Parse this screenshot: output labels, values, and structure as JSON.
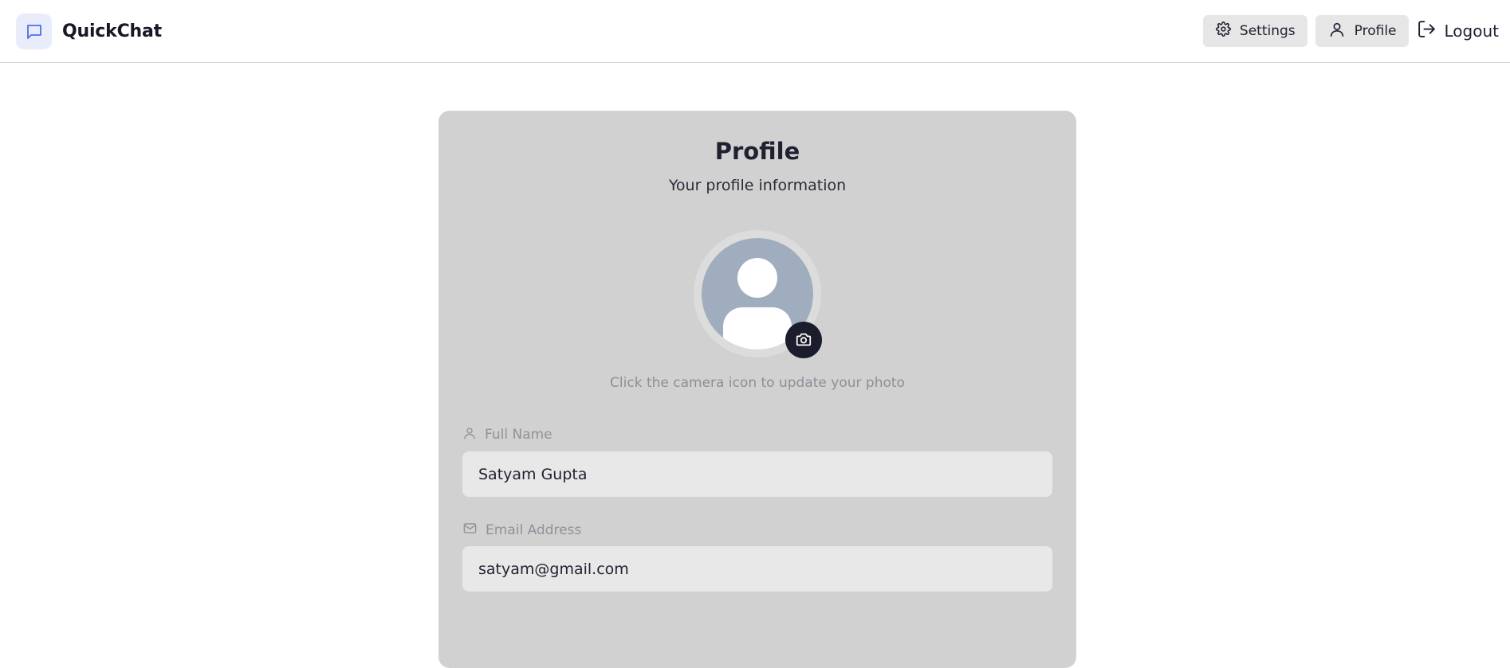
{
  "app": {
    "name": "QuickChat"
  },
  "nav": {
    "settings_label": "Settings",
    "profile_label": "Profile",
    "logout_label": "Logout"
  },
  "profile": {
    "title": "Profile",
    "subtitle": "Your profile information",
    "photo_hint": "Click the camera icon to update your photo",
    "full_name": {
      "label": "Full Name",
      "value": "Satyam Gupta"
    },
    "email": {
      "label": "Email Address",
      "value": "satyam@gmail.com"
    }
  },
  "colors": {
    "brand_accent": "#4f6bed",
    "card_background": "#d1d1d1",
    "camera_button": "#1c1d2c",
    "avatar_placeholder": "#a0adbe"
  }
}
